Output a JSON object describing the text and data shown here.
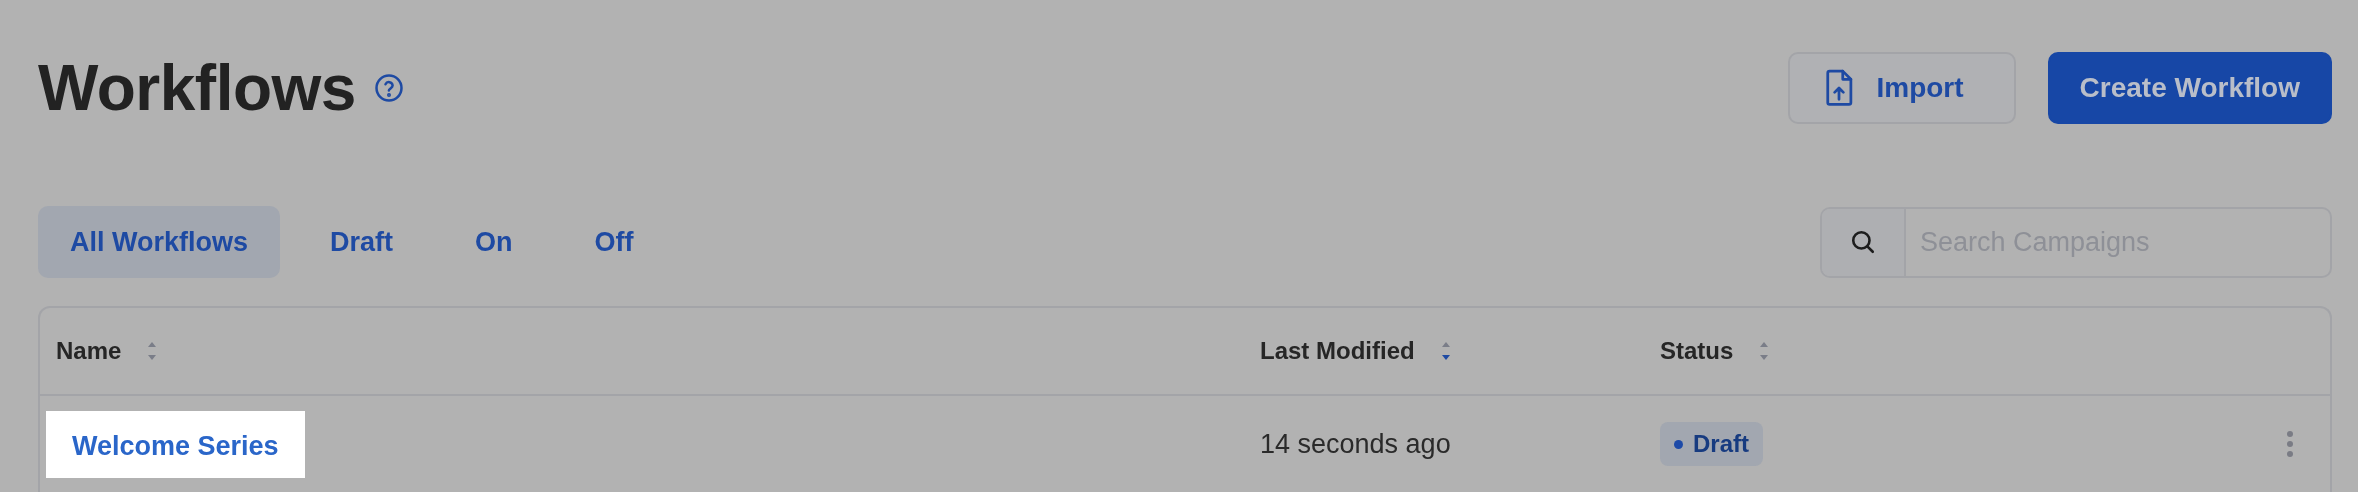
{
  "header": {
    "title": "Workflows",
    "actions": [
      {
        "kind": "secondary",
        "label": "Import"
      },
      {
        "kind": "primary",
        "label": "Create Workflow"
      }
    ]
  },
  "tabs": [
    {
      "label": "All Workflows",
      "selected": true
    },
    {
      "label": "Draft",
      "selected": false
    },
    {
      "label": "On",
      "selected": false
    },
    {
      "label": "Off",
      "selected": false
    }
  ],
  "search": {
    "placeholder": "Search Campaigns"
  },
  "table": {
    "columns": [
      {
        "label": "Name",
        "sorted": false
      },
      {
        "label": "Last Modified",
        "sorted": true
      },
      {
        "label": "Status",
        "sorted": false
      }
    ],
    "rows": [
      {
        "name": "Welcome Series",
        "highlighted": true,
        "last_modified": "14 seconds ago",
        "status": {
          "label": "Draft",
          "color": "#1d4aa8"
        }
      }
    ]
  }
}
